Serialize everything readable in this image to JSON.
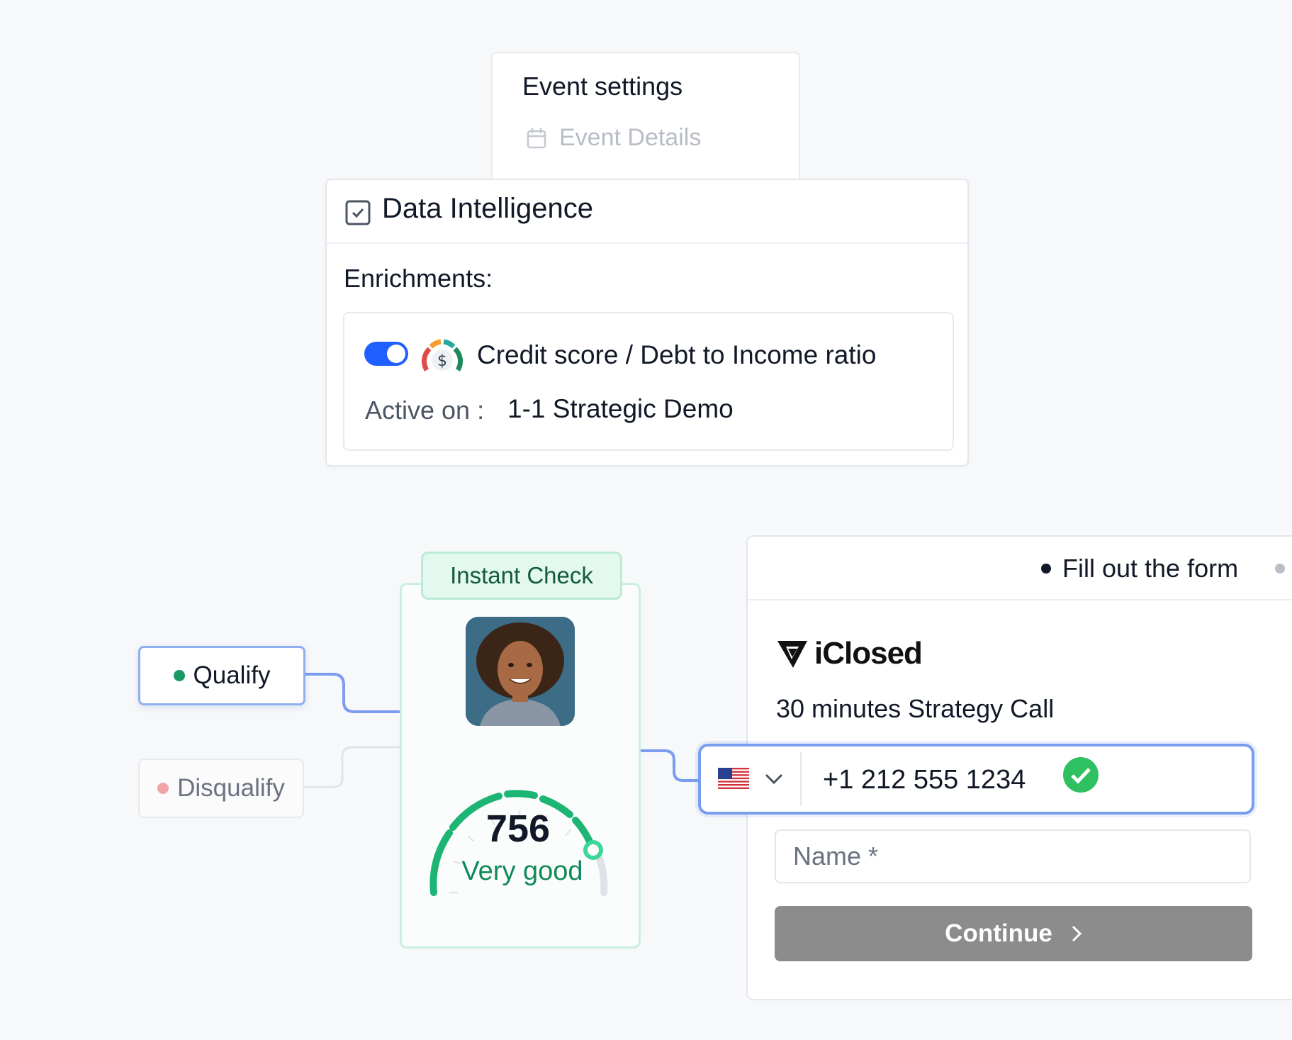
{
  "event_settings": {
    "title": "Event settings",
    "item_label": "Event Details",
    "item_icon": "calendar-icon"
  },
  "data_intelligence": {
    "title": "Data Intelligence",
    "header_icon": "checkbox-icon",
    "enrichments_label": "Enrichments:",
    "enrichment": {
      "enabled": true,
      "icon": "credit-gauge-icon",
      "label": "Credit score / Debt to Income ratio",
      "active_on_label": "Active on :",
      "active_on_value": "1-1 Strategic Demo"
    }
  },
  "flow": {
    "qualify_label": "Qualify",
    "disqualify_label": "Disqualify",
    "colors": {
      "qualify": "#1a9a63",
      "disqualify": "#f1a3a8",
      "connector": "#7b9df0"
    }
  },
  "instant_check": {
    "tab_label": "Instant Check",
    "avatar_icon": "avatar",
    "score": "756",
    "rating": "Very good"
  },
  "form": {
    "step_label": "Fill out the form",
    "brand_name": "iClosed",
    "subtitle": "30 minutes Strategy Call",
    "phone": {
      "country_icon": "us-flag-icon",
      "value": "+1 212 555 1234",
      "verified": true
    },
    "name_placeholder": "Name *",
    "continue_label": "Continue"
  }
}
